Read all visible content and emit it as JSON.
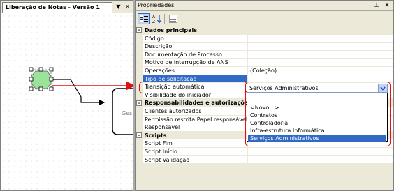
{
  "left": {
    "tab_title": "Liberação de Notas - Versão 1",
    "tab_dropdown": "▼",
    "tab_close": "✕",
    "diagram_label": "Ges"
  },
  "right": {
    "header_title": "Propriedades",
    "pin_glyph": "⊥",
    "close_glyph": "✕",
    "categories": {
      "c1": "Dados principais",
      "c2": "Responsabilidades e autorizações",
      "c3": "Scripts"
    },
    "props": {
      "p1": "Código",
      "p2": "Descrição",
      "p3": "Documentação de Processo",
      "p4": "Motivo de interrupção de ANS",
      "p5": "Operações",
      "p6": "Tipo de solicitação",
      "p7": "Transição automática",
      "p8": "Visibilidade do iniciador",
      "p9": "Clientes autorizados",
      "p10": "Permissão restrita Papel responsável",
      "p11": "Responsável",
      "p12": "Script Fim",
      "p13": "Script Início",
      "p14": "Script Validação"
    },
    "values": {
      "operacoes": "(Coleção)"
    },
    "dropdown": {
      "selected": "Serviços Administrativos",
      "options": [
        "<Novo...>",
        "Contratos",
        "Controladoria",
        "Infra-estrutura Informática",
        "Serviços Administrativos"
      ]
    }
  },
  "colors": {
    "selection": "#316ac5",
    "highlight": "#e01010",
    "node_fill": "#9be29b",
    "chrome": "#ece9d8"
  }
}
